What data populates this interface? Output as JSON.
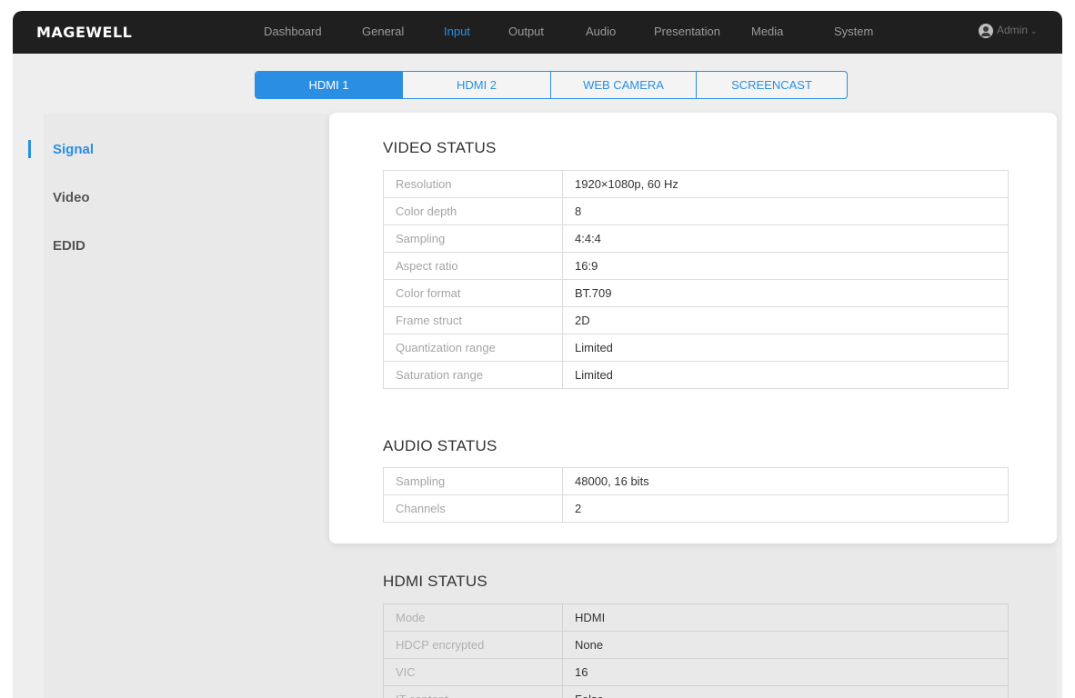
{
  "app": {
    "logo": "MAGEWELL"
  },
  "nav": [
    {
      "label": "Dashboard",
      "active": false
    },
    {
      "label": "General",
      "active": false
    },
    {
      "label": "Input",
      "active": true
    },
    {
      "label": "Output",
      "active": false
    },
    {
      "label": "Audio",
      "active": false
    },
    {
      "label": "Presentation",
      "active": false
    },
    {
      "label": "Media",
      "active": false
    },
    {
      "label": "System",
      "active": false
    }
  ],
  "user": {
    "name": "Admin",
    "icon": "user-icon",
    "caret_icon": "chevron-down-icon"
  },
  "tabs": [
    {
      "label": "HDMI 1",
      "active": true
    },
    {
      "label": "HDMI 2",
      "active": false
    },
    {
      "label": "WEB CAMERA",
      "active": false
    },
    {
      "label": "SCREENCAST",
      "active": false
    }
  ],
  "sidebar": {
    "items": [
      {
        "label": "Signal",
        "active": true
      },
      {
        "label": "Video",
        "active": false
      },
      {
        "label": "EDID",
        "active": false
      }
    ]
  },
  "video_status": {
    "title": "VIDEO STATUS",
    "rows": [
      {
        "key": "Resolution",
        "value": "1920×1080p, 60 Hz"
      },
      {
        "key": "Color depth",
        "value": "8"
      },
      {
        "key": "Sampling",
        "value": "4:4:4"
      },
      {
        "key": "Aspect ratio",
        "value": "16:9"
      },
      {
        "key": "Color format",
        "value": "BT.709"
      },
      {
        "key": "Frame struct",
        "value": "2D"
      },
      {
        "key": "Quantization range",
        "value": "Limited"
      },
      {
        "key": "Saturation range",
        "value": "Limited"
      }
    ]
  },
  "audio_status": {
    "title": "AUDIO STATUS",
    "rows": [
      {
        "key": "Sampling",
        "value": "48000, 16 bits"
      },
      {
        "key": "Channels",
        "value": "2"
      }
    ]
  },
  "hdmi_status": {
    "title": "HDMI STATUS",
    "rows": [
      {
        "key": "Mode",
        "value": "HDMI"
      },
      {
        "key": "HDCP encrypted",
        "value": "None"
      },
      {
        "key": "VIC",
        "value": "16"
      },
      {
        "key": "IT content",
        "value": "False"
      }
    ]
  },
  "colors": {
    "accent": "#2a8fe3",
    "navbar": "#1f1f1f",
    "background": "#eeeeee"
  }
}
